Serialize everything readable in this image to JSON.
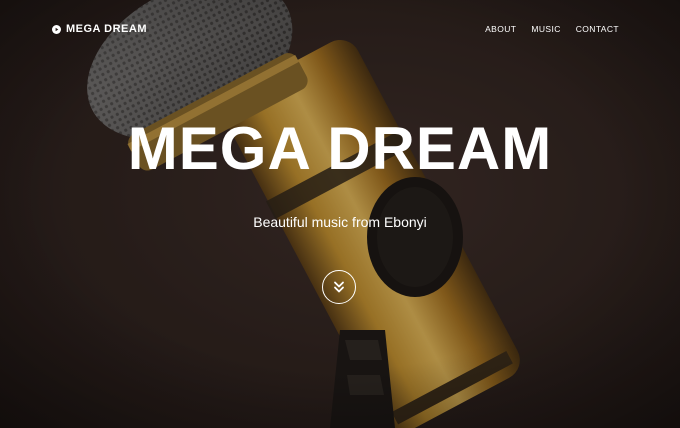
{
  "brand": {
    "name": "MEGA DREAM",
    "icon": "play-circle-icon"
  },
  "nav": {
    "items": [
      {
        "label": "ABOUT"
      },
      {
        "label": "MUSIC"
      },
      {
        "label": "CONTACT"
      }
    ]
  },
  "hero": {
    "title": "MEGA DREAM",
    "subtitle": "Beautiful music from Ebonyi",
    "scroll_icon": "double-chevron-down-icon"
  },
  "colors": {
    "background": "#2a1f1d",
    "text": "#ffffff",
    "mic_gold": "#c8952f"
  }
}
